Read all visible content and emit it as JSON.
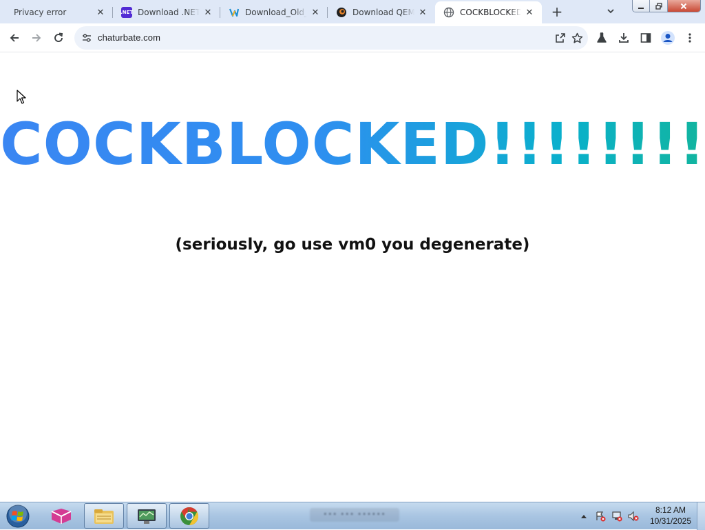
{
  "tabs": [
    {
      "title": "Privacy error",
      "favicon": "none",
      "active": false
    },
    {
      "title": "Download .NET",
      "favicon": "dotnet-icon",
      "active": false
    },
    {
      "title": "Download_Old_Bel",
      "favicon": "vs-icon",
      "active": false
    },
    {
      "title": "Download QEMU",
      "favicon": "qemu-icon",
      "active": false
    },
    {
      "title": "COCKBLOCKED",
      "favicon": "globe-icon",
      "active": true
    }
  ],
  "new_tab_symbol": "+",
  "toolbar": {
    "url": "chaturbate.com"
  },
  "page": {
    "headline": "COCKBLOCKED!!!!!!!!",
    "subline": "(seriously, go use vm0 you degenerate)"
  },
  "taskbar": {
    "blurred_text": "••• ••• ••••••",
    "clock_time": "8:12 AM",
    "clock_date": "10/31/2025"
  },
  "colors": {
    "tabstrip": "#dfe8f7",
    "omnibox": "#edf2fa",
    "headline_start": "#3a86f2",
    "headline_end": "#12b59e",
    "taskbar": "#a9c5e2"
  }
}
